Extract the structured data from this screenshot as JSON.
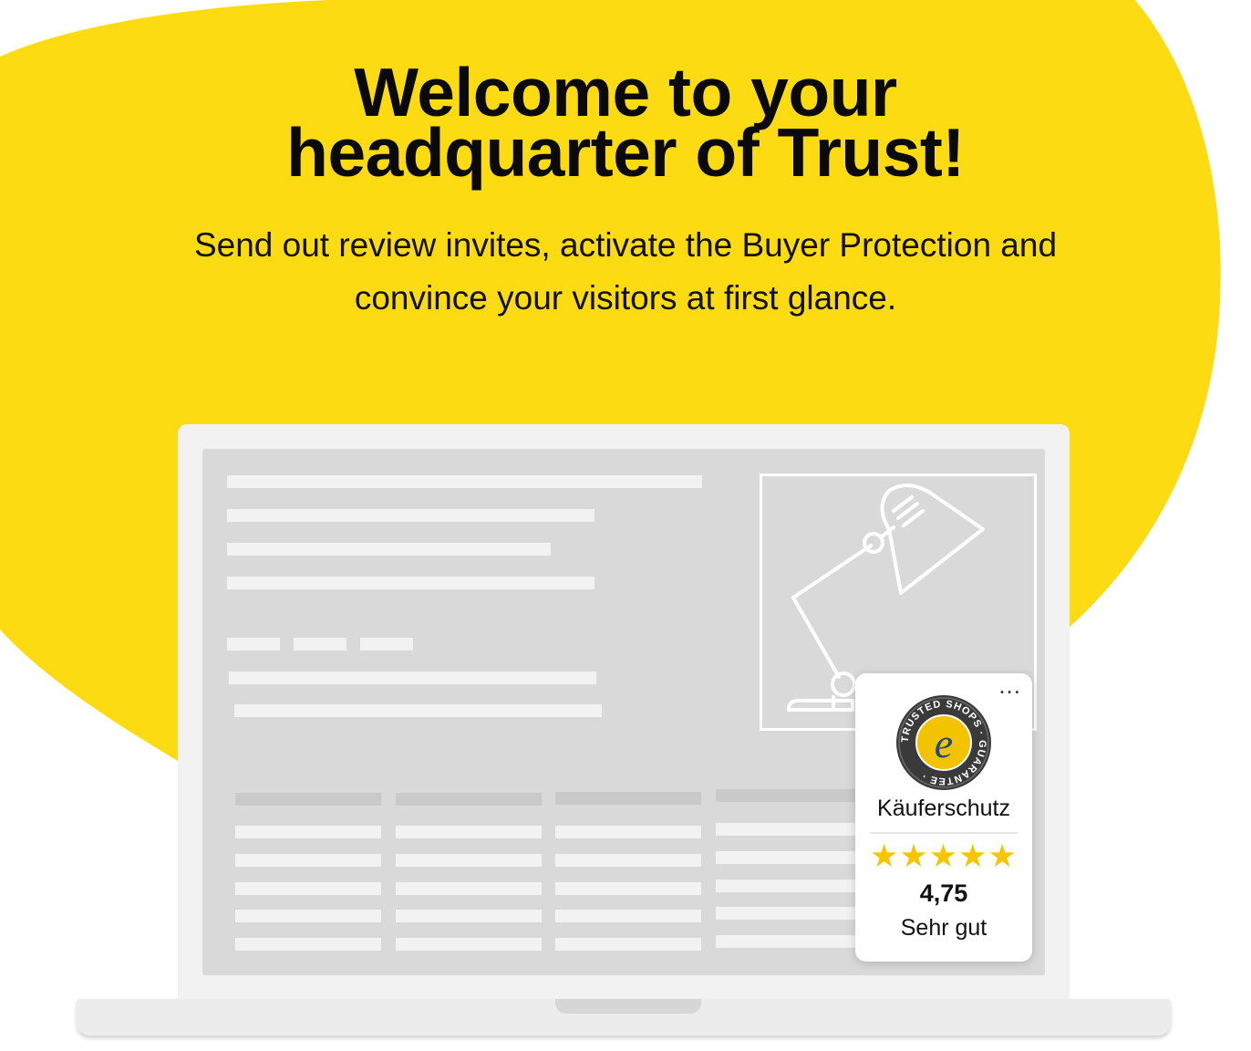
{
  "hero": {
    "title_line1": "Welcome to your",
    "title_line2": "headquarter of Trust!",
    "subtitle_line1": "Send out review invites, activate the Buyer Protection and",
    "subtitle_line2": "convince your visitors at first glance."
  },
  "colors": {
    "brand_yellow": "#FDDB12",
    "screen_placeholder": "#D9D9D9",
    "star_gold": "#F7C500"
  },
  "trustbadge": {
    "menu_label": "...",
    "seal_icon": "trusted-shops-e-seal",
    "seal_text": "TRUSTED SHOPS · GUARANTEE ·",
    "label": "Käuferschutz",
    "stars": "★★★★★",
    "rating_value": "4,75",
    "rating_text": "Sehr gut"
  },
  "illustration": {
    "icon": "desk-lamp-icon",
    "device": "laptop"
  }
}
